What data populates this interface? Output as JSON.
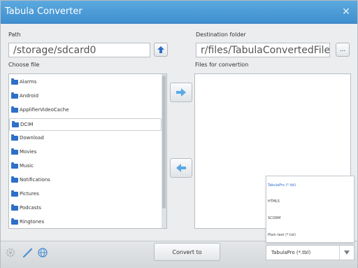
{
  "window": {
    "title": "Tabula Converter",
    "close_icon": "close-icon"
  },
  "source": {
    "path_label": "Path",
    "path_value": "/storage/sdcard0",
    "choose_label": "Choose file",
    "files": [
      {
        "name": "Alarms"
      },
      {
        "name": "Android"
      },
      {
        "name": "ApplifierVideoCache"
      },
      {
        "name": "DCIM"
      },
      {
        "name": "Download"
      },
      {
        "name": "Movies"
      },
      {
        "name": "Music"
      },
      {
        "name": "Notifications"
      },
      {
        "name": "Pictures"
      },
      {
        "name": "Podcasts"
      },
      {
        "name": "Ringtones"
      }
    ],
    "selected_file": "DCIM"
  },
  "destination": {
    "folder_label": "Destination folder",
    "folder_value": "r/files/TabulaConvertedFiles",
    "browse_label": "...",
    "files_label": "Files for convertion"
  },
  "footer": {
    "convert_label": "Convert to",
    "format_selected": "TabulaPro (*.tbl)",
    "format_options": [
      "TabulaPro (*.tbl)",
      "HTML5",
      "SCORM",
      "Plain text (*.txt)"
    ]
  },
  "colors": {
    "title_bar": "#4a9ad6",
    "accent_blue": "#2d6fc9",
    "arrow_blue": "#5aa9e6"
  }
}
